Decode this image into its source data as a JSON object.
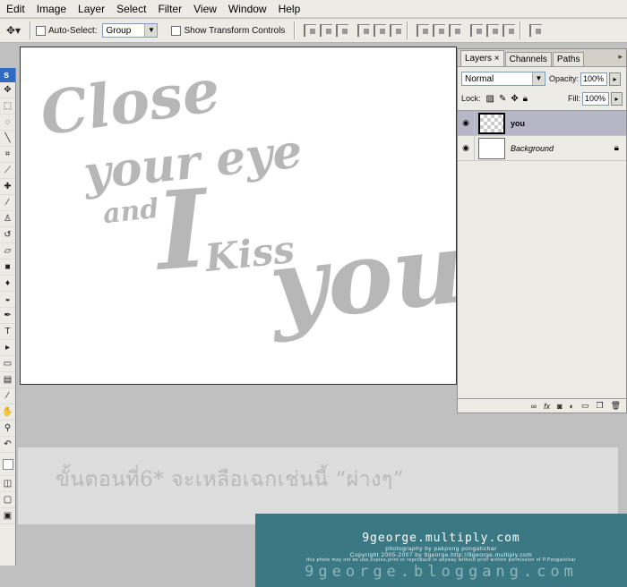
{
  "menu": [
    "Edit",
    "Image",
    "Layer",
    "Select",
    "Filter",
    "View",
    "Window",
    "Help"
  ],
  "options": {
    "auto_select_label": "Auto-Select:",
    "auto_select_value": "Group",
    "transform_label": "Show Transform Controls"
  },
  "toolbox": {
    "title": "s"
  },
  "canvas_text": {
    "line1": "Close",
    "line2": "your eye",
    "line3": "and",
    "line4": "I",
    "line5": "Kiss",
    "line6": "you"
  },
  "layers_panel": {
    "tabs": [
      "Layers",
      "Channels",
      "Paths"
    ],
    "tab_close": "×",
    "blend_mode": "Normal",
    "opacity_label": "Opacity:",
    "opacity_value": "100%",
    "lock_label": "Lock:",
    "fill_label": "Fill:",
    "fill_value": "100%",
    "layers": [
      {
        "name": "you",
        "selected": true,
        "thumb": "transparent"
      },
      {
        "name": "Background",
        "selected": false,
        "thumb": "white",
        "locked": true
      }
    ],
    "bottom_icons": [
      "link-icon",
      "fx-icon",
      "mask-icon",
      "adjustment-icon",
      "group-icon",
      "new-layer-icon",
      "trash-icon"
    ]
  },
  "caption": "ขั้นตอนที่6* จะเหลือเฉกเช่นนี้ “ผ่างๆ”",
  "credit": {
    "site": "9george.multiply.com",
    "line1": "photography by pakpong pongatichar",
    "line2": "Copyright 2005-2007 by 9george,http://9george.multiply.com",
    "line3": "this photo may not be use,copies,print or reproduce in anyway without prior written permission of P.Pongatichar",
    "big": "9george.bloggang.com"
  }
}
